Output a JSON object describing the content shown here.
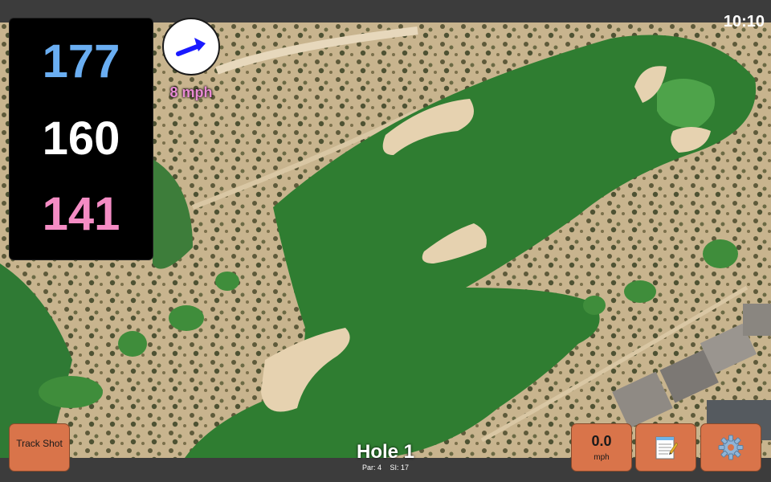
{
  "status": {
    "clock": "10:10"
  },
  "distances": {
    "back": "177",
    "middle": "160",
    "front": "141"
  },
  "wind": {
    "speed": "8 mph",
    "icon": "wind-arrow-icon"
  },
  "buttons": {
    "track_shot": "Track Shot",
    "speed_value": "0.0",
    "speed_unit": "mph",
    "notes_icon": "notepad-icon",
    "settings_icon": "gear-icon"
  },
  "hole": {
    "title": "Hole 1",
    "par": "Par: 4",
    "si": "SI: 17"
  },
  "colors": {
    "back_distance": "#6aaef2",
    "front_distance": "#f48cc4",
    "wind_speed_text": "#e98ad4",
    "wind_arrow": "#1a1aff",
    "button_bg": "#d9744a",
    "fairway": "#2d7a2e",
    "sand": "#e8d5b5"
  }
}
